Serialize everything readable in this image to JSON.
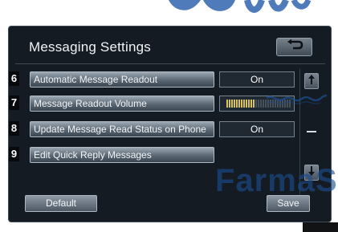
{
  "screen": {
    "title": "Messaging Settings",
    "back_icon": "back-arrow-icon"
  },
  "settings": {
    "items": [
      {
        "number": "6",
        "label": "Automatic Message Readout",
        "value": "On"
      },
      {
        "number": "7",
        "label": "Message Readout Volume",
        "volume_level": 0.45
      },
      {
        "number": "8",
        "label": "Update Message Read Status on Phone",
        "value": "On"
      },
      {
        "number": "9",
        "label": "Edit Quick Reply Messages"
      }
    ]
  },
  "scroll": {
    "up_icon": "scroll-up-icon",
    "down_icon": "scroll-down-icon"
  },
  "footer": {
    "default_label": "Default",
    "save_label": "Save"
  },
  "watermark": {
    "text": "FarmaS"
  },
  "colors": {
    "screen_background": "#151b22",
    "row_gradient_top": "#9ba7b3",
    "volume_fill": "#d8c463",
    "watermark": "#1b4d90"
  }
}
